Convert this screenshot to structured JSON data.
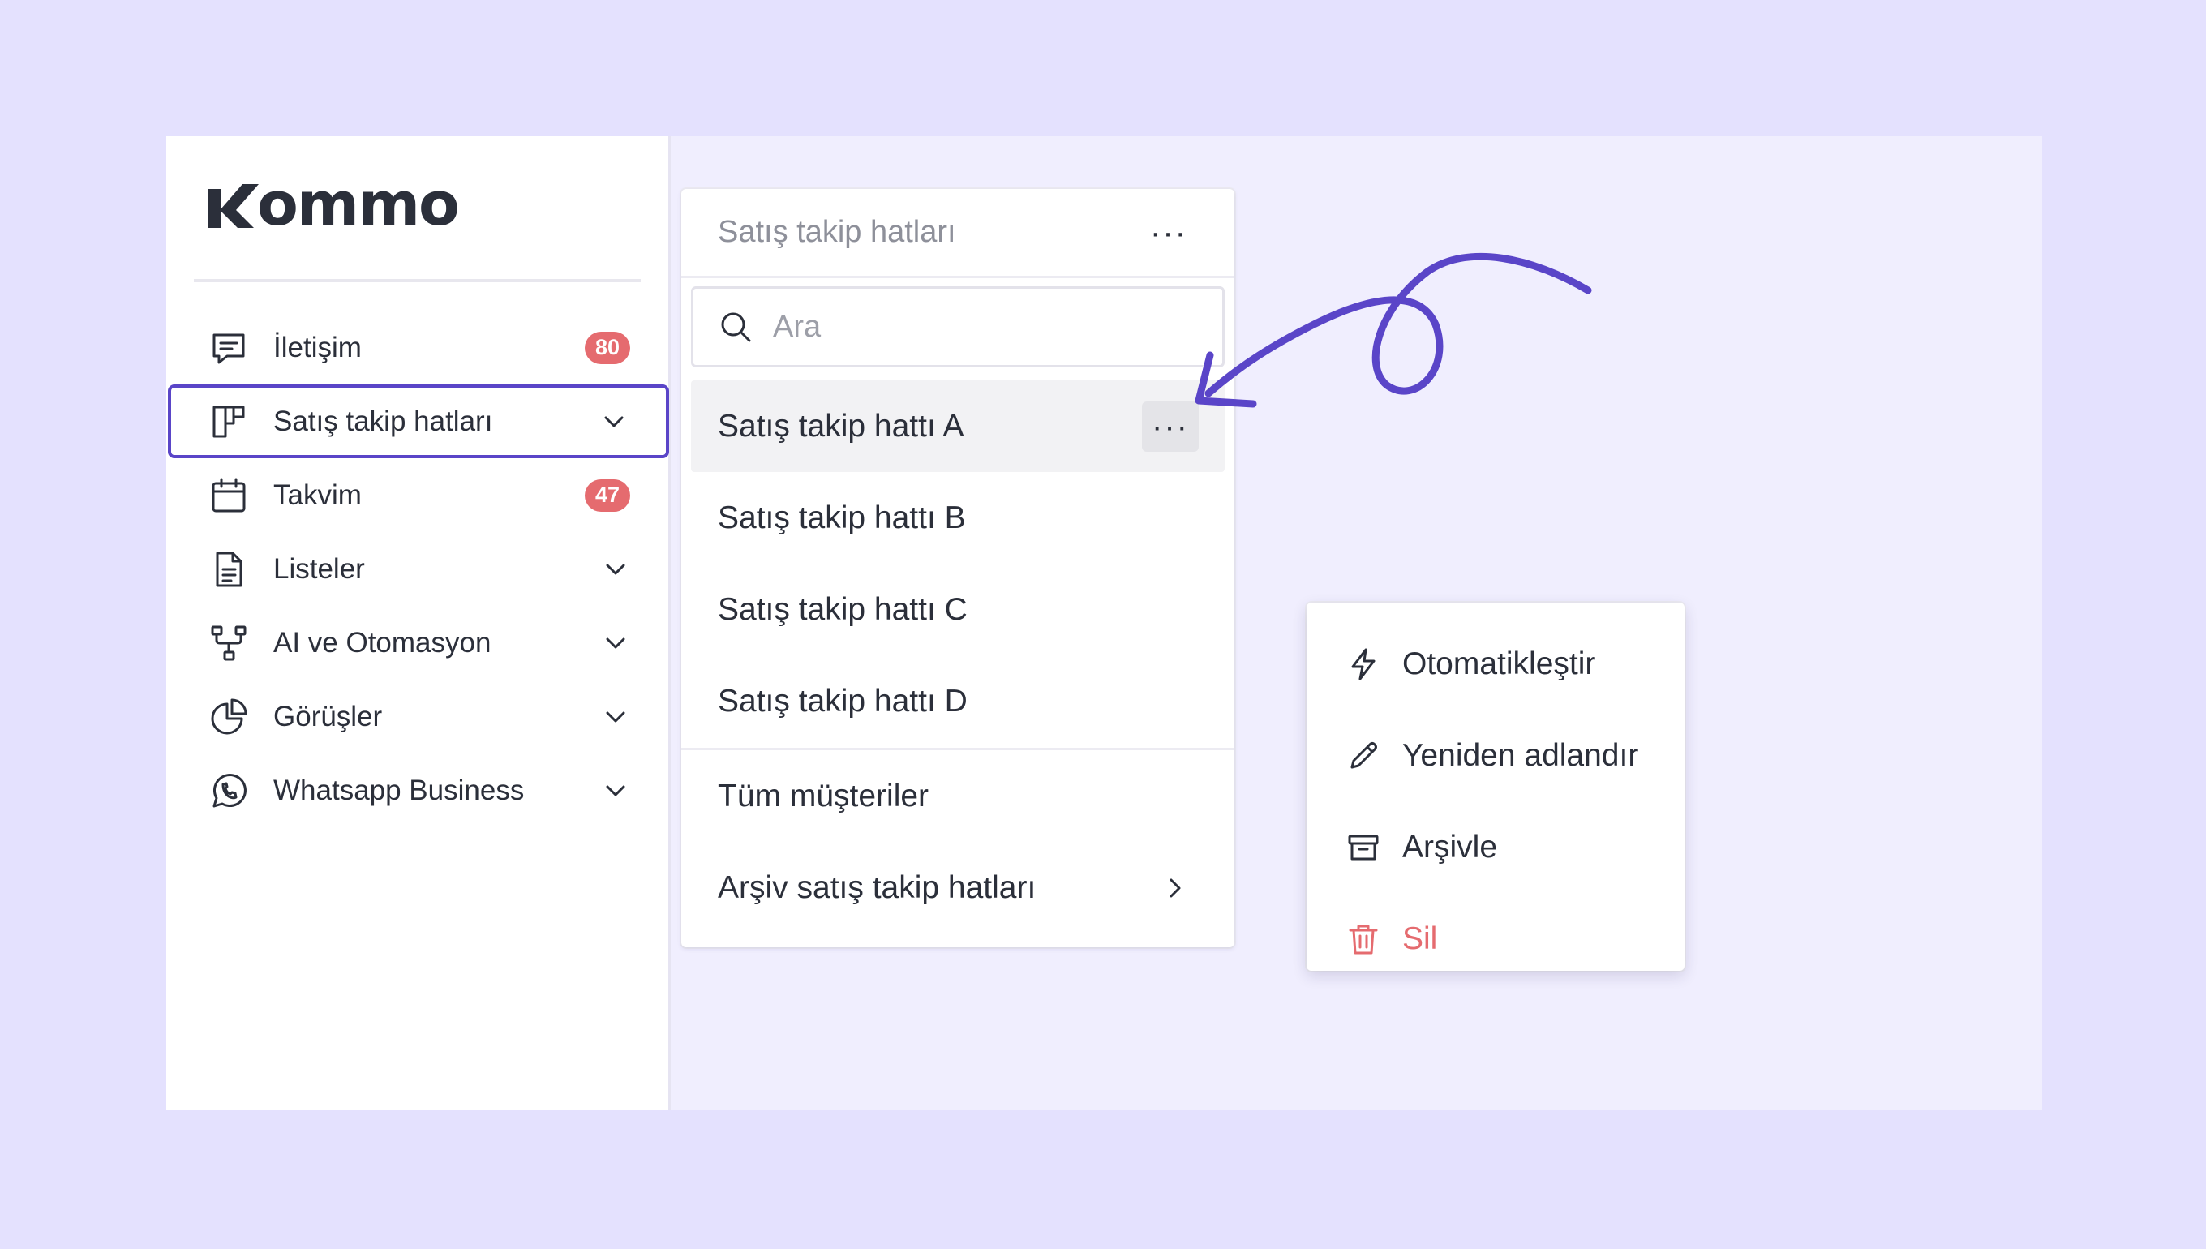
{
  "brand": {
    "logo_text": "ommo",
    "logo_lettering": "Kommo"
  },
  "sidebar": {
    "items": [
      {
        "label": "İletişim",
        "icon": "chat-icon",
        "badge": "80"
      },
      {
        "label": "Satış takip hatları",
        "icon": "pipeline-icon",
        "expandable": true,
        "active": true
      },
      {
        "label": "Takvim",
        "icon": "calendar-icon",
        "badge": "47"
      },
      {
        "label": "Listeler",
        "icon": "document-icon",
        "expandable": true
      },
      {
        "label": "AI ve Otomasyon",
        "icon": "automation-icon",
        "expandable": true
      },
      {
        "label": "Görüşler",
        "icon": "pie-chart-icon",
        "expandable": true
      },
      {
        "label": "Whatsapp Business",
        "icon": "whatsapp-icon",
        "expandable": true
      }
    ]
  },
  "pipelines_panel": {
    "title": "Satış takip hatları",
    "more_label": "···",
    "search": {
      "placeholder": "Ara",
      "value": ""
    },
    "pipelines": [
      {
        "label": "Satış takip hattı A"
      },
      {
        "label": "Satış takip hattı B"
      },
      {
        "label": "Satış takip hattı C"
      },
      {
        "label": "Satış takip hattı D"
      }
    ],
    "all_customers": "Tüm müşteriler",
    "archived": "Arşiv satış takip hatları"
  },
  "context_menu": {
    "items": [
      {
        "label": "Otomatikleştir",
        "icon": "lightning-icon"
      },
      {
        "label": "Yeniden adlandır",
        "icon": "pencil-icon"
      },
      {
        "label": "Arşivle",
        "icon": "archive-icon"
      },
      {
        "label": "Sil",
        "icon": "trash-icon"
      }
    ]
  },
  "colors": {
    "background": "#e4e1fe",
    "accent": "#5a45c8",
    "badge": "#e56b6f",
    "danger": "#e56b6f"
  }
}
